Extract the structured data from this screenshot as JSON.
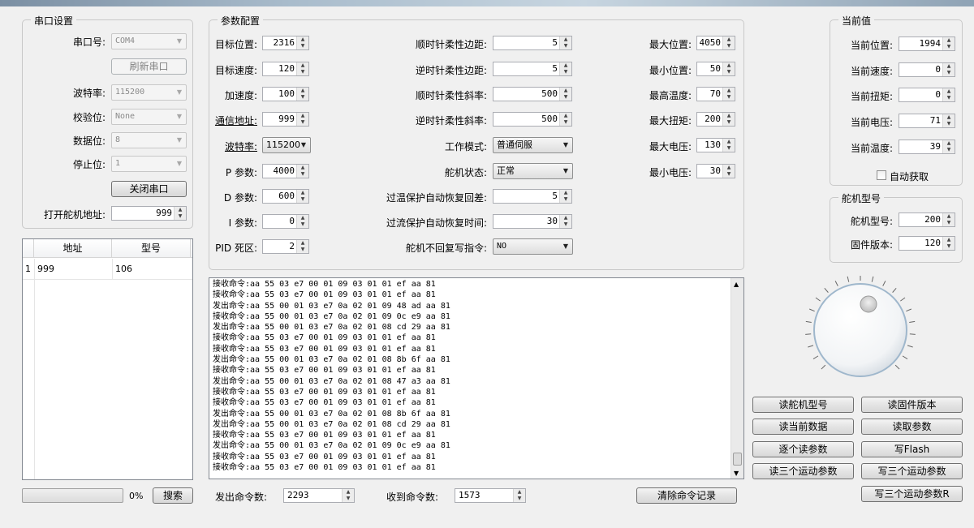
{
  "serial": {
    "title": "串口设置",
    "port_label": "串口号:",
    "port_value": "COM4",
    "refresh_button": "刷新串口",
    "baud_label": "波特率:",
    "baud_value": "115200",
    "parity_label": "校验位:",
    "parity_value": "None",
    "databits_label": "数据位:",
    "databits_value": "8",
    "stopbits_label": "停止位:",
    "stopbits_value": "1",
    "close_button": "关闭串口",
    "open_addr_label": "打开舵机地址:",
    "open_addr_value": "999"
  },
  "servo_table": {
    "headers": [
      "地址",
      "型号"
    ],
    "rows": [
      {
        "index": "1",
        "address": "999",
        "model": "106"
      }
    ]
  },
  "progress": {
    "percent_text": "0%",
    "percent": 0,
    "search_button": "搜索"
  },
  "params": {
    "title": "参数配置",
    "target_pos_label": "目标位置:",
    "target_pos": "2316",
    "target_speed_label": "目标速度:",
    "target_speed": "120",
    "accel_label": "加速度:",
    "accel": "100",
    "comm_addr_label": "通信地址:",
    "comm_addr": "999",
    "baud_label": "波特率:",
    "baud": "115200",
    "p_label": "P 参数:",
    "p": "4000",
    "d_label": "D 参数:",
    "d": "600",
    "i_label": "I  参数:",
    "i": "0",
    "pid_dead_label": "PID 死区:",
    "pid_dead": "2",
    "cw_margin_label": "顺时针柔性边距:",
    "cw_margin": "5",
    "ccw_margin_label": "逆时针柔性边距:",
    "ccw_margin": "5",
    "cw_slope_label": "顺时针柔性斜率:",
    "cw_slope": "500",
    "ccw_slope_label": "逆时针柔性斜率:",
    "ccw_slope": "500",
    "mode_label": "工作模式:",
    "mode": "普通伺服",
    "state_label": "舵机状态:",
    "state": "正常",
    "ot_recover_label": "过温保护自动恢复回差:",
    "ot_recover": "5",
    "oc_recover_label": "过流保护自动恢复时间:",
    "oc_recover": "30",
    "no_reply_label": "舵机不回复写指令:",
    "no_reply": "NO",
    "max_pos_label": "最大位置:",
    "max_pos": "4050",
    "min_pos_label": "最小位置:",
    "min_pos": "50",
    "max_temp_label": "最高温度:",
    "max_temp": "70",
    "max_torque_label": "最大扭矩:",
    "max_torque": "200",
    "max_volt_label": "最大电压:",
    "max_volt": "130",
    "min_volt_label": "最小电压:",
    "min_volt": "30"
  },
  "current": {
    "title": "当前值",
    "pos_label": "当前位置:",
    "pos": "1994",
    "speed_label": "当前速度:",
    "speed": "0",
    "torque_label": "当前扭矩:",
    "torque": "0",
    "volt_label": "当前电压:",
    "volt": "71",
    "temp_label": "当前温度:",
    "temp": "39",
    "auto_label": "自动获取"
  },
  "model": {
    "title": "舵机型号",
    "model_label": "舵机型号:",
    "model": "200",
    "fw_label": "固件版本:",
    "fw": "120"
  },
  "log": {
    "lines": [
      "接收命令:aa 55 03 e7 00 01 09 03 01 01 ef aa 81",
      "接收命令:aa 55 03 e7 00 01 09 03 01 01 ef aa 81",
      "发出命令:aa 55 00 01 03 e7 0a 02 01 09 48 ad aa 81",
      "接收命令:aa 55 00 01 03 e7 0a 02 01 09 0c e9 aa 81",
      "发出命令:aa 55 00 01 03 e7 0a 02 01 08 cd 29 aa 81",
      "接收命令:aa 55 03 e7 00 01 09 03 01 01 ef aa 81",
      "接收命令:aa 55 03 e7 00 01 09 03 01 01 ef aa 81",
      "发出命令:aa 55 00 01 03 e7 0a 02 01 08 8b 6f aa 81",
      "接收命令:aa 55 03 e7 00 01 09 03 01 01 ef aa 81",
      "发出命令:aa 55 00 01 03 e7 0a 02 01 08 47 a3 aa 81",
      "接收命令:aa 55 03 e7 00 01 09 03 01 01 ef aa 81",
      "接收命令:aa 55 03 e7 00 01 09 03 01 01 ef aa 81",
      "发出命令:aa 55 00 01 03 e7 0a 02 01 08 8b 6f aa 81",
      "发出命令:aa 55 00 01 03 e7 0a 02 01 08 cd 29 aa 81",
      "接收命令:aa 55 03 e7 00 01 09 03 01 01 ef aa 81",
      "发出命令:aa 55 00 01 03 e7 0a 02 01 09 0c e9 aa 81",
      "接收命令:aa 55 03 e7 00 01 09 03 01 01 ef aa 81",
      "接收命令:aa 55 03 e7 00 01 09 03 01 01 ef aa 81"
    ],
    "sent_label": "发出命令数:",
    "sent": "2293",
    "recv_label": "收到命令数:",
    "recv": "1573",
    "clear_button": "清除命令记录"
  },
  "actions": {
    "read_model": "读舵机型号",
    "read_fw": "读固件版本",
    "read_current": "读当前数据",
    "read_params": "读取参数",
    "read_each": "逐个读参数",
    "write_flash": "写Flash",
    "read_motion": "读三个运动参数",
    "write_motion": "写三个运动参数",
    "write_motion_r": "写三个运动参数R"
  }
}
